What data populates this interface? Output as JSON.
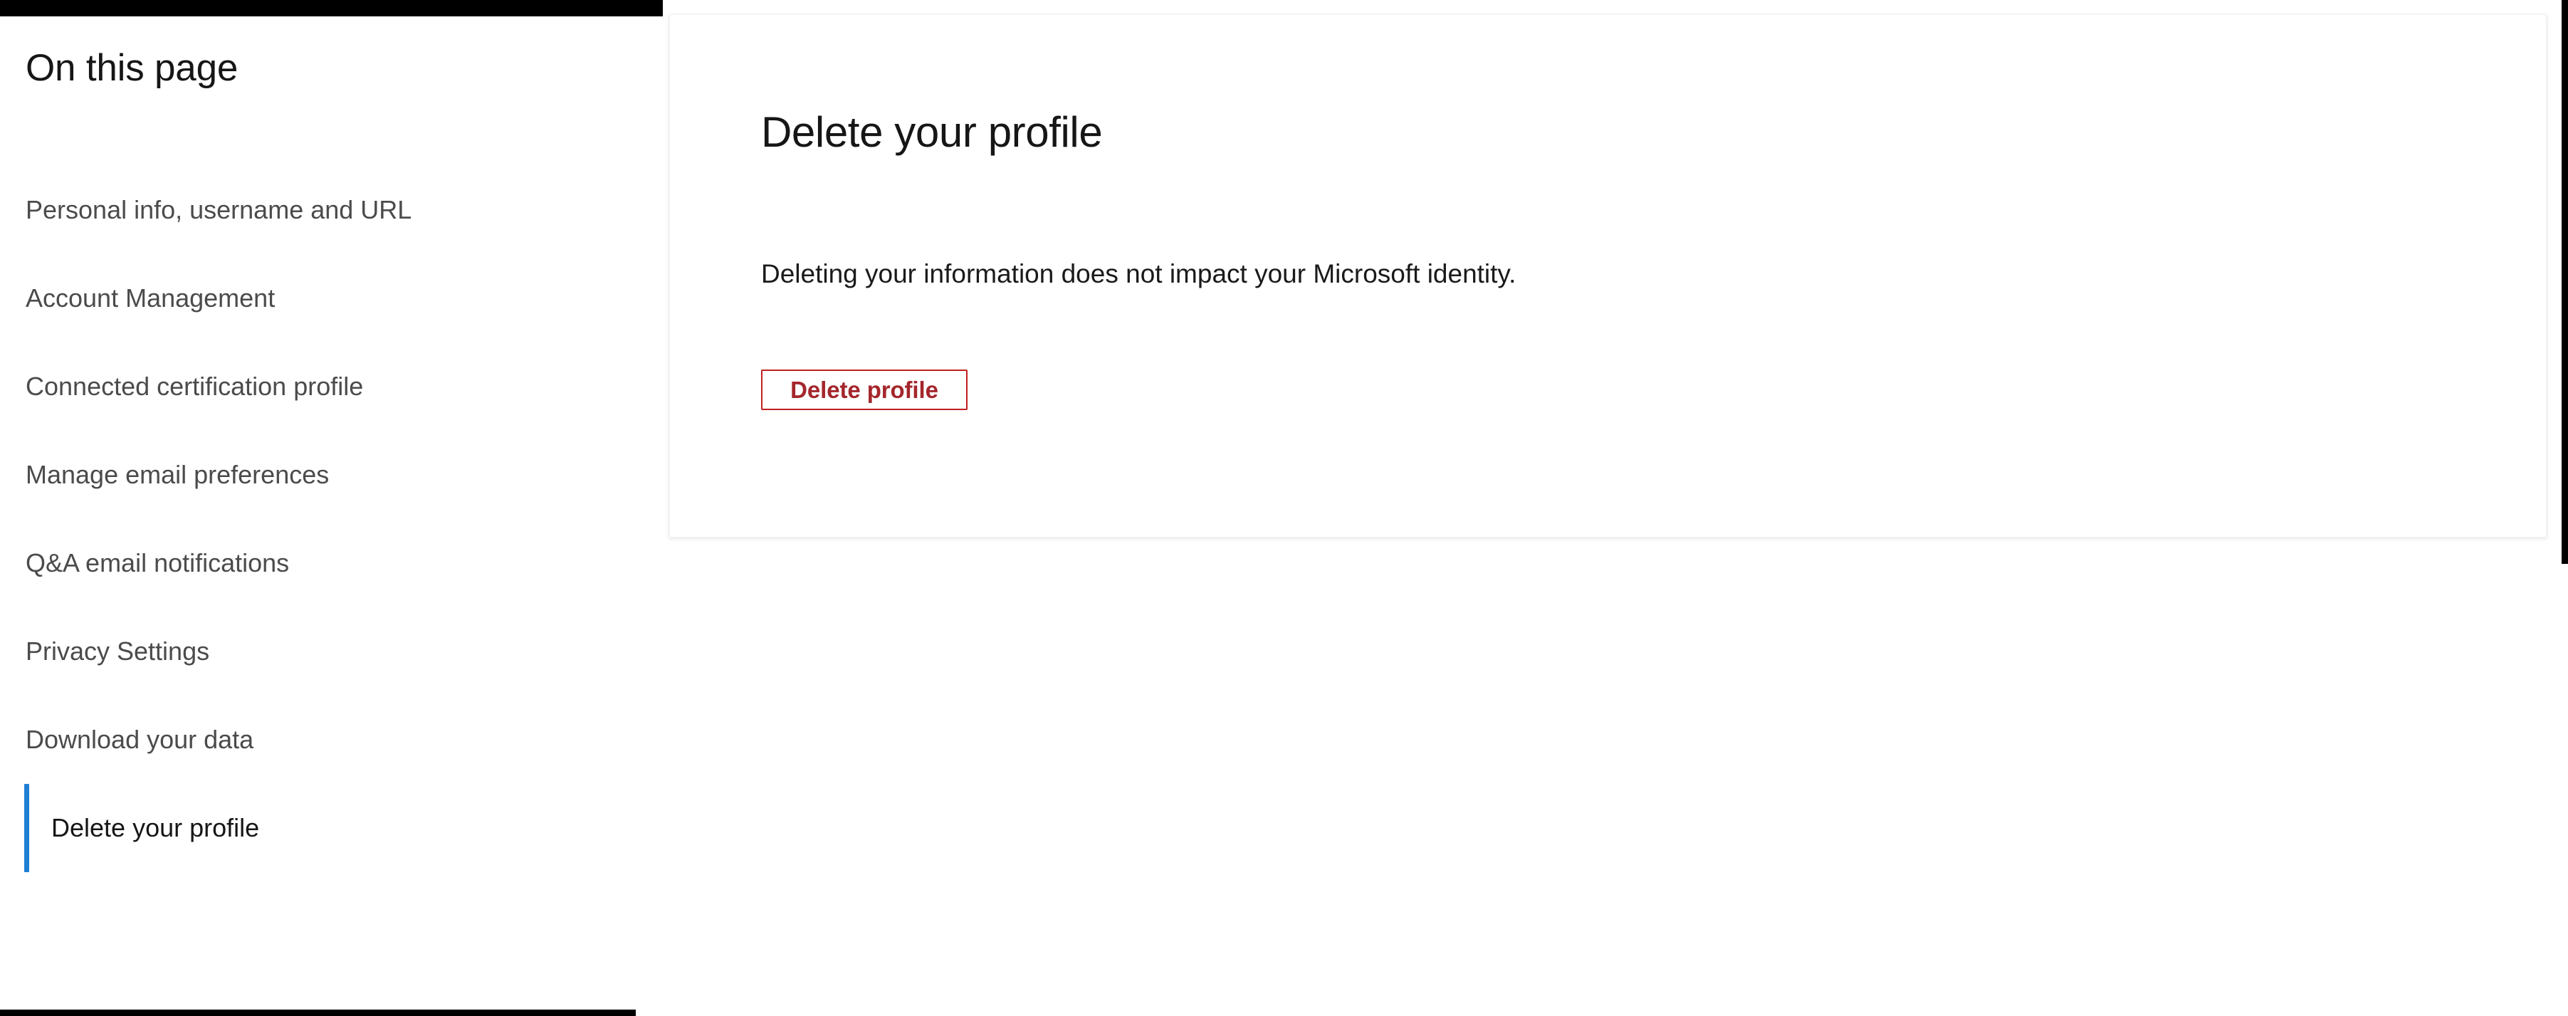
{
  "colors": {
    "accent_blue": "#1f7fd4",
    "danger_red": "#c0201f",
    "danger_text": "#a4262c",
    "text_primary": "#161616",
    "text_muted": "#4b4b4b",
    "chrome_black": "#000000",
    "card_background": "#ffffff"
  },
  "toc": {
    "title": "On this page",
    "items": [
      {
        "label": "Personal info, username and URL",
        "active": false
      },
      {
        "label": "Account Management",
        "active": false
      },
      {
        "label": "Connected certification profile",
        "active": false
      },
      {
        "label": "Manage email preferences",
        "active": false
      },
      {
        "label": "Q&A email notifications",
        "active": false
      },
      {
        "label": "Privacy Settings",
        "active": false
      },
      {
        "label": "Download your data",
        "active": false
      },
      {
        "label": "Delete your profile",
        "active": true
      }
    ]
  },
  "main": {
    "title": "Delete your profile",
    "description": "Deleting your information does not impact your Microsoft identity.",
    "delete_button_label": "Delete profile"
  }
}
